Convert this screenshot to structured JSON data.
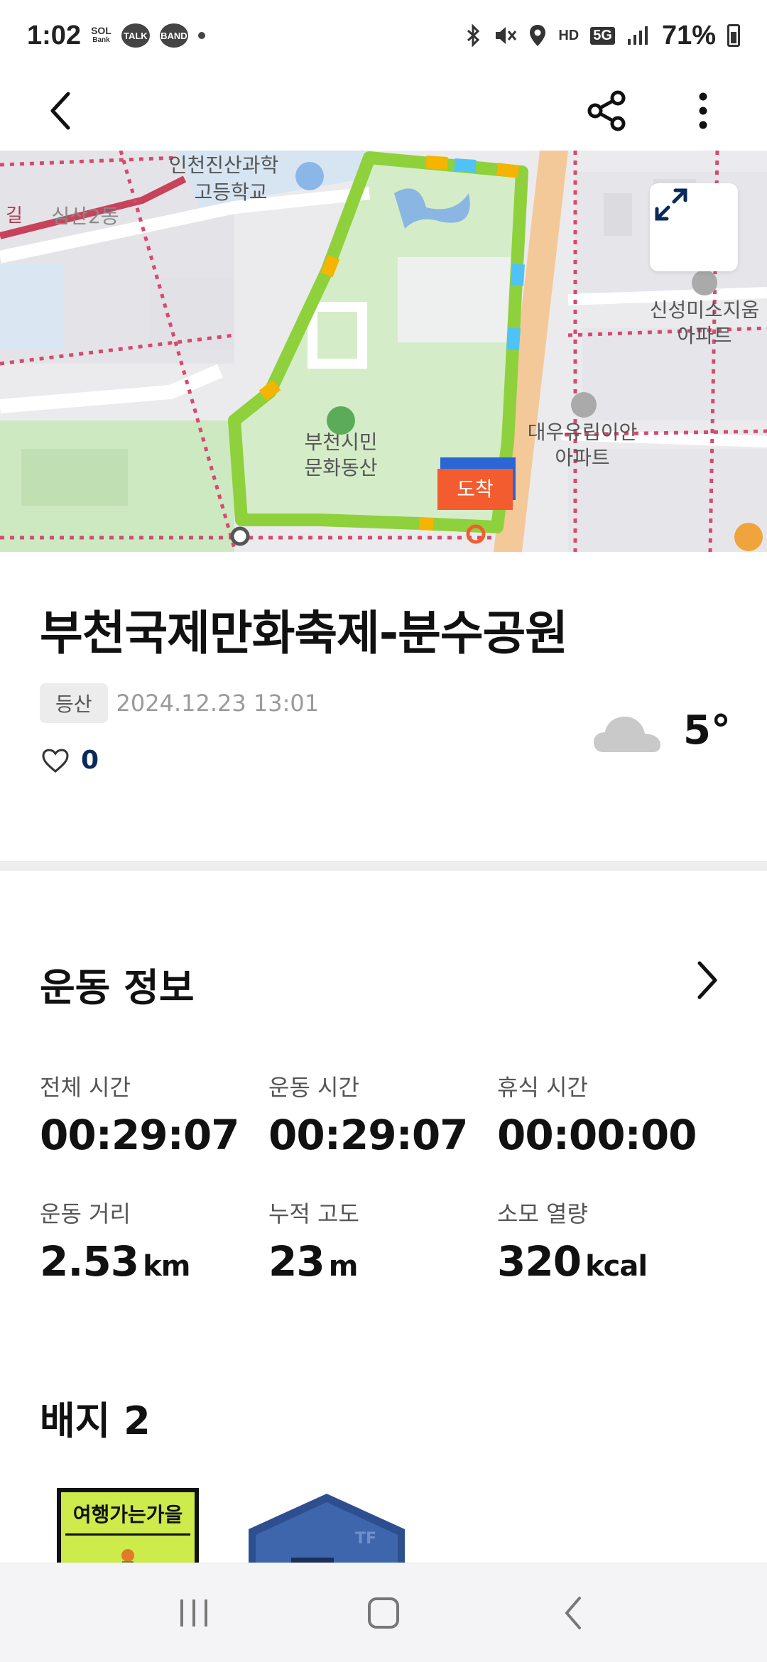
{
  "status_bar": {
    "time": "1:02",
    "apps": [
      "SOL",
      "TALK",
      "BAND"
    ],
    "sol_sub": "Bank",
    "network": "5G",
    "hd": "HD",
    "battery": "71%"
  },
  "app_bar": {
    "back_icon": "chevron-left-icon",
    "share_icon": "share-icon",
    "more_icon": "more-vertical-icon"
  },
  "map": {
    "labels": {
      "school": "인천진산과학\n고등학교",
      "school_l1": "인천진산과학",
      "school_l2": "고등학교",
      "district": "심산2동",
      "road": "길",
      "park_l1": "부천시민",
      "park_l2": "문화동산",
      "apt1_l1": "신성미소지움",
      "apt1_l2": "아파트",
      "apt2_l1": "대우유림이안",
      "apt2_l2": "아파트",
      "arrival": "도착"
    },
    "route_color": "#8ed13c",
    "expand_icon": "expand-icon"
  },
  "activity": {
    "title": "부천국제만화축제-분수공원",
    "category": "등산",
    "datetime": "2024.12.23 13:01",
    "likes": "0",
    "weather_icon": "cloud-icon",
    "temperature": "5°"
  },
  "exercise_info": {
    "title": "운동 정보",
    "stats": [
      {
        "label": "전체 시간",
        "value": "00:29:07",
        "unit": ""
      },
      {
        "label": "운동 시간",
        "value": "00:29:07",
        "unit": ""
      },
      {
        "label": "휴식 시간",
        "value": "00:00:00",
        "unit": ""
      },
      {
        "label": "운동 거리",
        "value": "2.53",
        "unit": "km"
      },
      {
        "label": "누적 고도",
        "value": "23",
        "unit": "m"
      },
      {
        "label": "소모 열량",
        "value": "320",
        "unit": "kcal"
      }
    ]
  },
  "badges": {
    "title": "배지 2",
    "items": [
      {
        "text": "여행가는가을"
      },
      {
        "text": "TF"
      }
    ]
  },
  "nav_bar": {
    "recents_icon": "recents-icon",
    "home_icon": "home-icon",
    "back_icon": "back-icon"
  }
}
